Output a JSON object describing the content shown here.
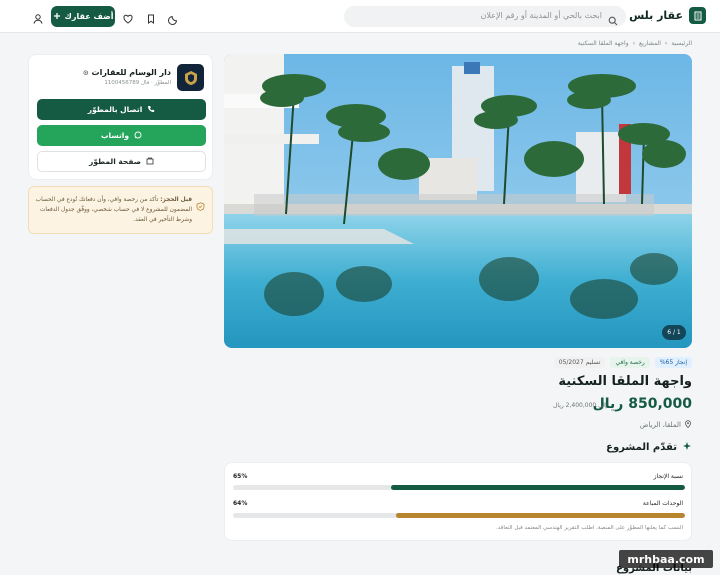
{
  "header": {
    "brand": "عقار بلس",
    "search_placeholder": "ابحث بالحي أو المدينة أو رقم الإعلان",
    "add_button": "أضف عقارك"
  },
  "breadcrumb": [
    "الرئيسية",
    "المشاريع",
    "واجهة الملقا السكنية"
  ],
  "gallery": {
    "counter": "1 / 6"
  },
  "project": {
    "badges": {
      "completion": "إنجاز 65%",
      "wafi": "رخصة وافي",
      "delivery": "تسليم 05/2027"
    },
    "title": "واجهة الملقا السكنية",
    "price_from": "850,000 ريال",
    "price_to": "إلى 2,400,000 ريال",
    "location": "الملقا، الرياض"
  },
  "progress": {
    "heading": "تقدّم المشروع",
    "rows": [
      {
        "label": "نسبة الإنجاز",
        "pct_text": "65%",
        "value": 0.65,
        "color": "#155a43"
      },
      {
        "label": "الوحدات المباعة",
        "pct_text": "64%",
        "value": 0.64,
        "color": "#b6852e"
      }
    ],
    "note": "النسب كما يعلنها المطوّر على المنصة. اطلب التقرير الهندسي المعتمد قبل التعاقد."
  },
  "next_section": {
    "heading": "بيانات المشروع"
  },
  "developer": {
    "name": "دار الوسام للعقارات",
    "meta": "المطوّر · فال 1100456789",
    "call_button": "اتصال بالمطوّر",
    "whatsapp_button": "واتساب",
    "page_button": "صفحة المطوّر"
  },
  "notice": {
    "bold": "قبل الحجز:",
    "text": " تأكد من رخصة وافي، وأن دفعاتك تُودع في الحساب المضمون للمشروع لا في حساب شخصي، ووفّق جدول الدفعات وشرط التأخير في العقد."
  },
  "watermark": "mrhbaa.com",
  "colors": {
    "primary": "#155a43",
    "whatsapp": "#25a55b",
    "sold": "#b6852e"
  }
}
